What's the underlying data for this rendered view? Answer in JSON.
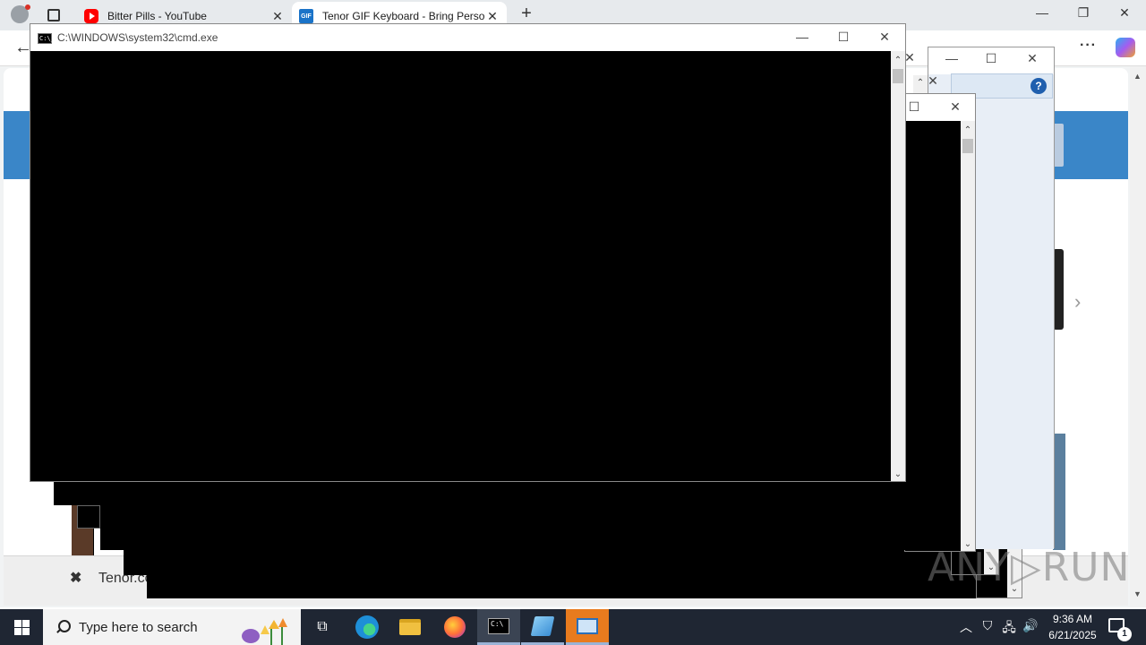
{
  "browser": {
    "tabs": [
      {
        "title": "Bitter Pills - YouTube",
        "favicon": "youtube-icon"
      },
      {
        "title": "Tenor GIF Keyboard - Bring Personality To Your Conversations",
        "favicon": "gif-icon",
        "active": true
      }
    ],
    "page_footer_text": "Tenor.co"
  },
  "cmd_window": {
    "title": "C:\\WINDOWS\\system32\\cmd.exe",
    "icon_text": "C:\\_"
  },
  "help_button_label": "?",
  "taskbar": {
    "search_placeholder": "Type here to search",
    "apps": [
      "task-view",
      "edge",
      "file-explorer",
      "firefox",
      "cmd",
      "notepad",
      "remote-desktop"
    ],
    "clock_time": "9:36 AM",
    "clock_date": "6/21/2025",
    "notification_count": "1"
  },
  "watermark": "ANY▷RUN",
  "colors": {
    "taskbar": "#1f2633",
    "console": "#000000",
    "accent_orange": "#e87b1e",
    "page_banner": "#3a86c8"
  }
}
